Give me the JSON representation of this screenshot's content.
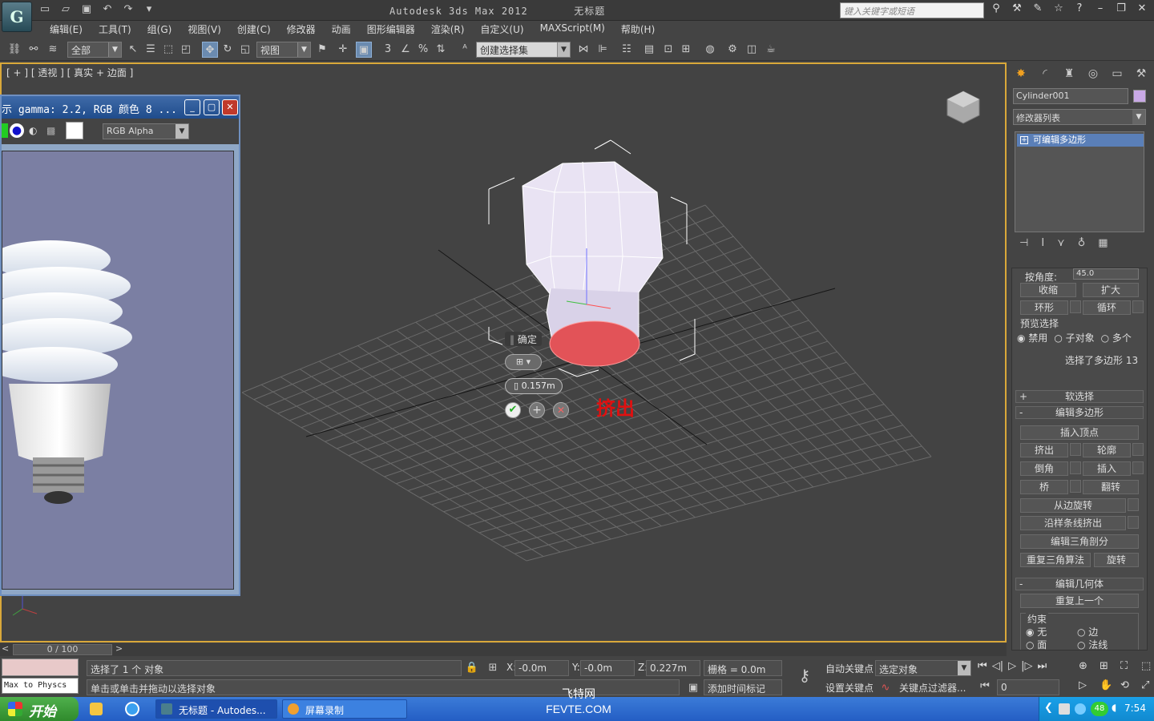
{
  "titlebar": {
    "app_title": "Autodesk 3ds Max  2012",
    "doc_title": "无标题",
    "search_placeholder": "键入关键字或短语"
  },
  "menus": [
    "编辑(E)",
    "工具(T)",
    "组(G)",
    "视图(V)",
    "创建(C)",
    "修改器",
    "动画",
    "图形编辑器",
    "渲染(R)",
    "自定义(U)",
    "MAXScript(M)",
    "帮助(H)"
  ],
  "toolbar": {
    "selection_filter": "全部",
    "ref_coord": "视图",
    "named_selection": "创建选择集"
  },
  "viewport": {
    "label": "[ + ] [ 透视 ] [ 真实 + 边面 ]",
    "caddy_ok": "确定",
    "caddy_value": "0.157m",
    "annotation": "挤出",
    "annotation_color": "#e01010"
  },
  "framebuffer": {
    "title": "示 gamma: 2.2, RGB 颜色 8 ...",
    "channel": "RGB Alpha"
  },
  "command_panel": {
    "object_name": "Cylinder001",
    "modifier_list": "修改器列表",
    "stack_item": "可编辑多边形",
    "by_angle_label": "按角度:",
    "by_angle_value": "45.0",
    "shrink": "收缩",
    "grow": "扩大",
    "ring": "环形",
    "loop": "循环",
    "preview_title": "预览选择",
    "preview_options": [
      "禁用",
      "子对象",
      "多个"
    ],
    "selection_info": "选择了多边形 13",
    "soft_selection": "软选择",
    "edit_polygons": "编辑多边形",
    "insert_vertex": "插入顶点",
    "extrude": "挤出",
    "outline": "轮廓",
    "bevel": "倒角",
    "inset": "插入",
    "bridge": "桥",
    "flip": "翻转",
    "hinge_from_edge": "从边旋转",
    "extrude_along_spline": "沿样条线挤出",
    "edit_triangulation": "编辑三角剖分",
    "retriangulate": "重复三角算法",
    "turn": "旋转",
    "edit_geometry": "编辑几何体",
    "repeat_last": "重复上一个",
    "constraints_title": "约束",
    "constraints": [
      "无",
      "边",
      "面",
      "法线"
    ]
  },
  "timeslider": {
    "frame": "0 / 100"
  },
  "status": {
    "listener": "Max to Physcs",
    "selection": "选择了 1 个 对象",
    "prompt": "单击或单击并拖动以选择对象",
    "x_label": "X:",
    "x_value": "-0.0m",
    "y_label": "Y:",
    "y_value": "-0.0m",
    "z_label": "Z:",
    "z_value": "0.227m",
    "grid": "栅格 = 0.0m",
    "add_time_tag": "添加时间标记",
    "auto_key": "自动关键点",
    "set_key": "设置关键点",
    "selected_objects": "选定对象",
    "key_filters": "关键点过滤器...",
    "frame_field": "0"
  },
  "taskbar": {
    "start": "开始",
    "items": [
      "无标题 - Autodes...",
      "屏幕录制"
    ],
    "clock": "7:54",
    "tray_badge": "48"
  },
  "watermark": {
    "line1": "飞特网",
    "line2": "FEVTE.COM"
  }
}
